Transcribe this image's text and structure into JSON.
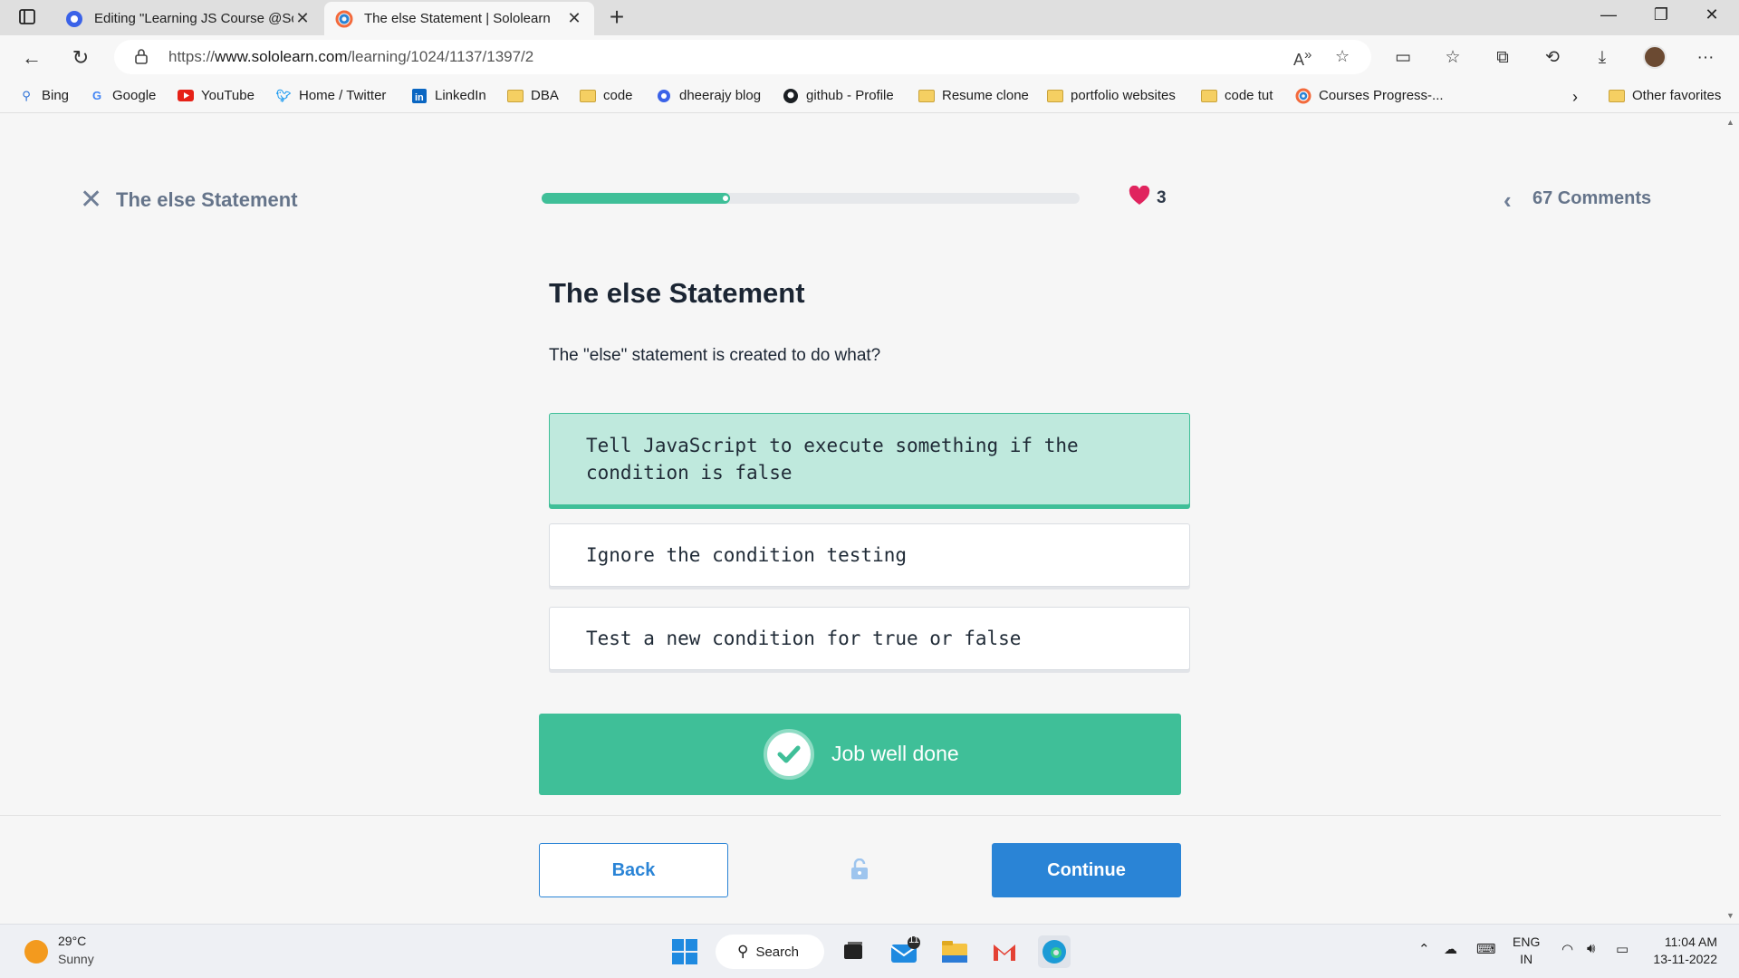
{
  "browser": {
    "tabs": [
      {
        "title": "Editing \"Learning JS Course @Sc",
        "active": false
      },
      {
        "title": "The else Statement | Sololearn",
        "active": true
      }
    ],
    "url_prefix": "https://",
    "url_domain": "www.sololearn.com",
    "url_path": "/learning/1024/1137/1397/2",
    "favorites": [
      {
        "label": "Bing",
        "icon": "bing-icon"
      },
      {
        "label": "Google",
        "icon": "google-icon"
      },
      {
        "label": "YouTube",
        "icon": "youtube-icon"
      },
      {
        "label": "Home / Twitter",
        "icon": "twitter-icon"
      },
      {
        "label": "LinkedIn",
        "icon": "linkedin-icon"
      },
      {
        "label": "DBA",
        "icon": "folder-icon"
      },
      {
        "label": "code",
        "icon": "folder-icon"
      },
      {
        "label": "dheerajy blog",
        "icon": "blog-icon"
      },
      {
        "label": "github - Profile",
        "icon": "github-icon"
      },
      {
        "label": "Resume clone",
        "icon": "folder-icon"
      },
      {
        "label": "portfolio websites",
        "icon": "folder-icon"
      },
      {
        "label": "code tut",
        "icon": "folder-icon"
      },
      {
        "label": "Courses Progress-...",
        "icon": "sololearn-icon"
      }
    ],
    "other_favorites": "Other favorites"
  },
  "lesson": {
    "title": "The else Statement",
    "progress": 0.35,
    "hearts": "3",
    "comments": "67 Comments"
  },
  "question": {
    "title": "The else Statement",
    "text": "The \"else\" statement is created to do what?",
    "options": [
      {
        "line1": "Tell JavaScript to execute something if the",
        "line2": "condition is false",
        "selected": true
      },
      {
        "line1": "Ignore the condition testing",
        "line2": "",
        "selected": false
      },
      {
        "line1": "Test a new condition for true or false",
        "line2": "",
        "selected": false
      }
    ]
  },
  "result": {
    "message": "Job well done"
  },
  "footer": {
    "back": "Back",
    "continue": "Continue"
  },
  "taskbar": {
    "temp": "29°C",
    "condition": "Sunny",
    "search": "Search",
    "mail_badge": "11",
    "lang1": "ENG",
    "lang2": "IN",
    "time": "11:04 AM",
    "date": "13-11-2022"
  },
  "colors": {
    "accent": "#3fbf98",
    "primary": "#2a84d6",
    "heart": "#e0245e"
  }
}
